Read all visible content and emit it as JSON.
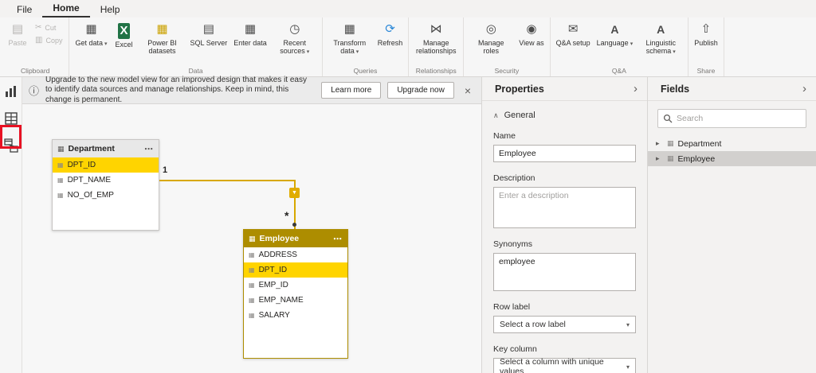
{
  "menu": {
    "file": "File",
    "home": "Home",
    "help": "Help"
  },
  "ribbon": {
    "groups": [
      {
        "label": "Clipboard",
        "items": [
          {
            "label": "Paste",
            "icon": "paste",
            "disabled": true
          },
          {
            "stack": [
              {
                "label": "Cut",
                "icon": "cut",
                "disabled": true
              },
              {
                "label": "Copy",
                "icon": "copy",
                "disabled": true
              }
            ]
          }
        ]
      },
      {
        "label": "Data",
        "items": [
          {
            "label": "Get data",
            "icon": "get-data",
            "dropdown": true
          },
          {
            "label": "Excel",
            "icon": "excel"
          },
          {
            "label": "Power BI datasets",
            "icon": "powerbi-datasets"
          },
          {
            "label": "SQL Server",
            "icon": "sql-server"
          },
          {
            "label": "Enter data",
            "icon": "enter-data"
          },
          {
            "label": "Recent sources",
            "icon": "recent-sources",
            "dropdown": true
          }
        ]
      },
      {
        "label": "Queries",
        "items": [
          {
            "label": "Transform data",
            "icon": "transform-data",
            "dropdown": true
          },
          {
            "label": "Refresh",
            "icon": "refresh"
          }
        ]
      },
      {
        "label": "Relationships",
        "items": [
          {
            "label": "Manage relationships",
            "icon": "manage-relationships"
          }
        ]
      },
      {
        "label": "Security",
        "items": [
          {
            "label": "Manage roles",
            "icon": "manage-roles"
          },
          {
            "label": "View as",
            "icon": "view-as"
          }
        ]
      },
      {
        "label": "Q&A",
        "items": [
          {
            "label": "Q&A setup",
            "icon": "qa-setup"
          },
          {
            "label": "Language",
            "icon": "language",
            "dropdown": true
          },
          {
            "label": "Linguistic schema",
            "icon": "linguistic-schema",
            "dropdown": true
          }
        ]
      },
      {
        "label": "Share",
        "items": [
          {
            "label": "Publish",
            "icon": "publish"
          }
        ]
      }
    ]
  },
  "sidebar": {
    "views": [
      "report-view",
      "data-view",
      "model-view"
    ],
    "active": "model-view"
  },
  "banner": {
    "text": "Upgrade to the new model view for an improved design that makes it easy to identify data sources and manage relationships. Keep in mind, this change is permanent.",
    "learn_more": "Learn more",
    "upgrade_now": "Upgrade now"
  },
  "canvas": {
    "tables": [
      {
        "name": "Department",
        "fields": [
          "DPT_ID",
          "DPT_NAME",
          "NO_Of_EMP"
        ],
        "highlighted": "DPT_ID",
        "selected": false
      },
      {
        "name": "Employee",
        "fields": [
          "ADDRESS",
          "DPT_ID",
          "EMP_ID",
          "EMP_NAME",
          "SALARY"
        ],
        "highlighted": "DPT_ID",
        "selected": true
      }
    ],
    "relationship": {
      "from_cardinality": "1",
      "to_cardinality": "*"
    }
  },
  "properties": {
    "title": "Properties",
    "section_general": "General",
    "name_label": "Name",
    "name_value": "Employee",
    "description_label": "Description",
    "description_placeholder": "Enter a description",
    "synonyms_label": "Synonyms",
    "synonyms_value": "employee",
    "row_label": "Row label",
    "row_value": "Select a row label",
    "key_column_label": "Key column",
    "key_column_value": "Select a column with unique values"
  },
  "fields": {
    "title": "Fields",
    "search_placeholder": "Search",
    "items": [
      "Department",
      "Employee"
    ],
    "selected": "Employee"
  }
}
